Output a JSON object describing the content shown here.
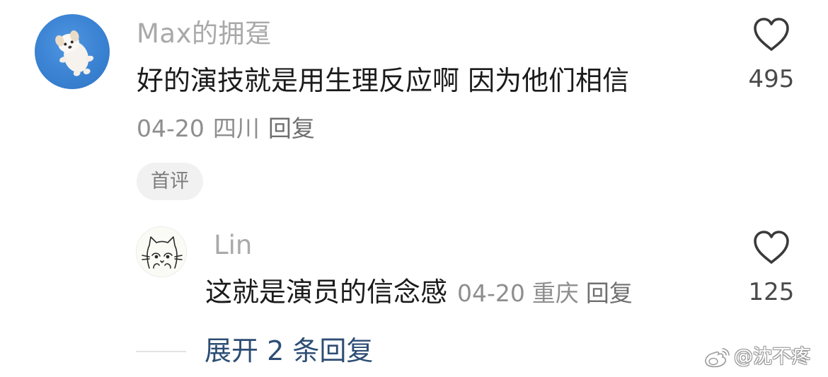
{
  "comment": {
    "author": "Max的拥趸",
    "text": "好的演技就是用生理反应啊 因为他们相信",
    "date": "04-20",
    "location": "四川",
    "reply_label": "回复",
    "likes": "495",
    "badge": "首评",
    "avatar_icon": "puppy-avatar",
    "like_icon": "heart-outline-icon"
  },
  "reply": {
    "author": "Lin",
    "text": "这就是演员的信念感",
    "date": "04-20",
    "location": "重庆",
    "reply_label": "回复",
    "likes": "125",
    "avatar_icon": "cat-doodle-avatar",
    "like_icon": "heart-outline-icon"
  },
  "expand": {
    "label": "展开 2 条回复"
  },
  "watermark": {
    "text": "@沈不疼",
    "logo_icon": "weibo-logo"
  },
  "colors": {
    "link": "#2d4d74",
    "secondary_text": "#8e8e8e",
    "author_text": "#a9a9a9",
    "badge_bg": "#f1f1f1",
    "avatar_bg": "#3a82d2"
  }
}
